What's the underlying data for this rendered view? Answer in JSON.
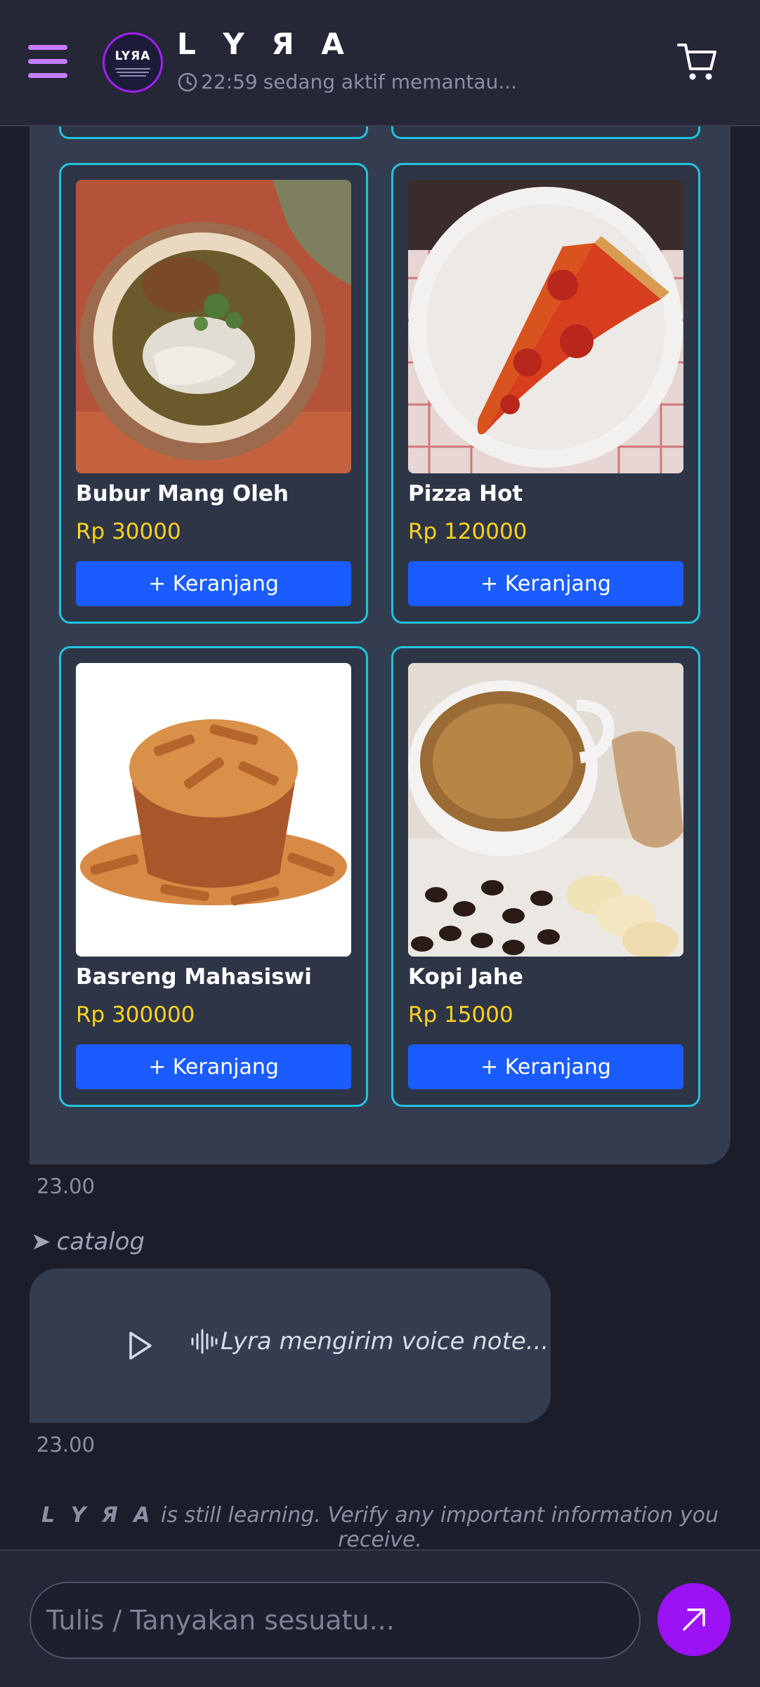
{
  "header": {
    "title": "LYRA",
    "title_display": "L Y Я A",
    "avatar_text": "LYЯA",
    "status_time": "22:59",
    "status_text": "sedang aktif memantau..."
  },
  "products": [
    {
      "name": "Bubur Mang Oleh",
      "price": "Rp 30000",
      "button": "+ Keranjang",
      "image": "bubur-ayam-bowl"
    },
    {
      "name": "Pizza Hot",
      "price": "Rp 120000",
      "button": "+ Keranjang",
      "image": "pepperoni-pizza-slice"
    },
    {
      "name": "Basreng Mahasiswi",
      "price": "Rp 300000",
      "button": "+ Keranjang",
      "image": "basreng-snack-bowl"
    },
    {
      "name": "Kopi Jahe",
      "price": "Rp 15000",
      "button": "+ Keranjang",
      "image": "ginger-coffee-cup"
    }
  ],
  "messages": {
    "products_timestamp": "23.00",
    "command_label": "catalog",
    "voice_note_text": "Lyra mengirim voice note...",
    "voice_timestamp": "23.00"
  },
  "disclaimer": {
    "brand": "L Y Я A",
    "text": " is still learning. Verify any important information you receive."
  },
  "composer": {
    "placeholder": "Tulis / Tanyakan sesuatu..."
  },
  "colors": {
    "accent": "#9b12f5",
    "menu_icon": "#c77dff",
    "card_border": "#22c3de",
    "price": "#ffd21f",
    "cart_button": "#1a5cff",
    "bubble": "#343d4f",
    "background": "#1c1d2b"
  },
  "icons": [
    "menu-icon",
    "clock-icon",
    "cart-icon",
    "play-icon",
    "audio-wave-icon",
    "send-icon"
  ]
}
